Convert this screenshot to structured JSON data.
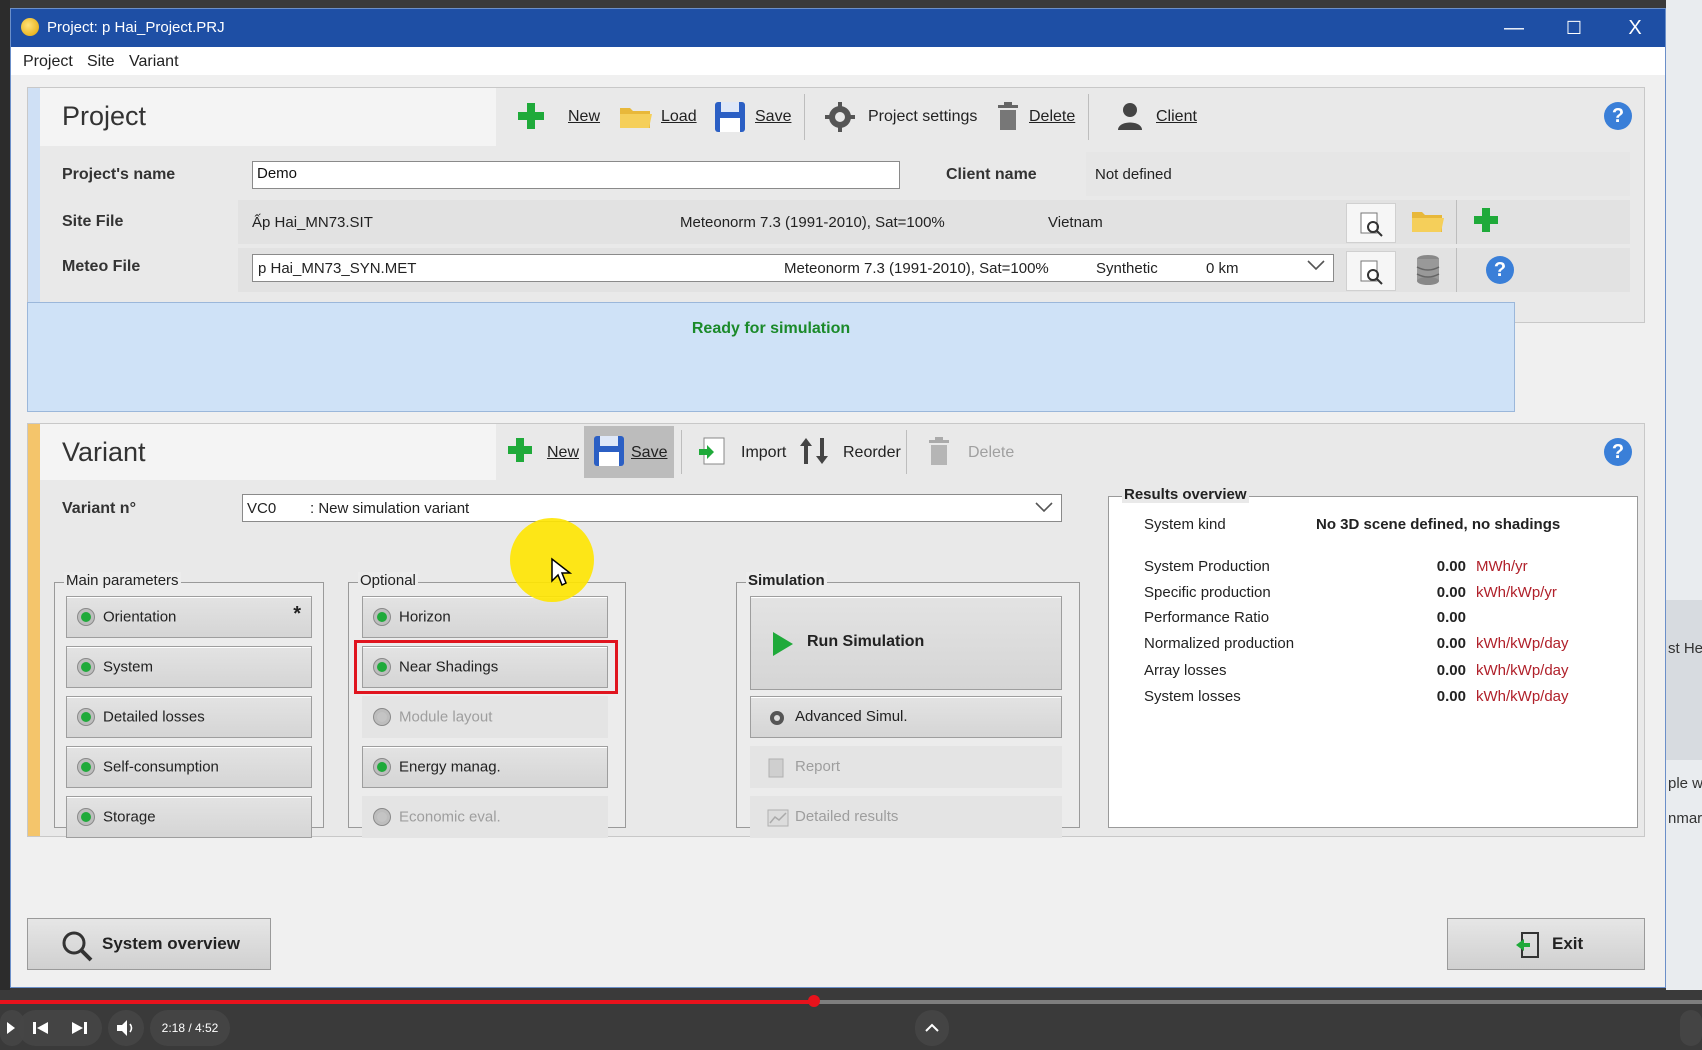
{
  "window": {
    "title": "Project:  p Hai_Project.PRJ",
    "minimize": "—",
    "maximize": "☐",
    "close": "X"
  },
  "menu": [
    "Project",
    "Site",
    "Variant"
  ],
  "project_panel": {
    "title": "Project",
    "toolbar": {
      "new": "New",
      "load": "Load",
      "save": "Save",
      "settings": "Project settings",
      "delete": "Delete",
      "client": "Client"
    },
    "project_name_label": "Project's name",
    "project_name_value": "Demo",
    "client_name_label": "Client name",
    "client_name_value": "Not defined",
    "site_file_label": "Site File",
    "site_file_name": "Ấp Hai_MN73.SIT",
    "site_file_source": "Meteonorm 7.3 (1991-2010), Sat=100%",
    "site_file_country": "Vietnam",
    "meteo_file_label": "Meteo File",
    "meteo_file_name": "p Hai_MN73_SYN.MET",
    "meteo_file_source": "Meteonorm 7.3 (1991-2010), Sat=100%",
    "meteo_file_type": "Synthetic",
    "meteo_file_distance": "0 km"
  },
  "status": {
    "text": "Ready for simulation",
    "color": "#1b8a2a"
  },
  "variant_panel": {
    "title": "Variant",
    "toolbar": {
      "new": "New",
      "save": "Save",
      "import": "Import",
      "reorder": "Reorder",
      "delete": "Delete"
    },
    "variant_label": "Variant n°",
    "variant_code": "VC0",
    "variant_name": ": New simulation variant"
  },
  "main_parameters": {
    "legend": "Main parameters",
    "items": [
      "Orientation",
      "System",
      "Detailed losses",
      "Self-consumption",
      "Storage"
    ],
    "orientation_marker": "*"
  },
  "optional": {
    "legend": "Optional",
    "items": [
      "Horizon",
      "Near Shadings",
      "Module layout",
      "Energy manag.",
      "Economic eval."
    ]
  },
  "simulation": {
    "legend": "Simulation",
    "run": "Run Simulation",
    "advanced": "Advanced Simul.",
    "report": "Report",
    "detailed": "Detailed results"
  },
  "results": {
    "legend": "Results overview",
    "system_kind_label": "System kind",
    "system_kind_value": "No 3D scene defined, no shadings",
    "rows": [
      {
        "label": "System Production",
        "value": "0.00",
        "unit": "MWh/yr"
      },
      {
        "label": "Specific production",
        "value": "0.00",
        "unit": "kWh/kWp/yr"
      },
      {
        "label": "Performance Ratio",
        "value": "0.00",
        "unit": ""
      },
      {
        "label": "Normalized production",
        "value": "0.00",
        "unit": "kWh/kWp/day"
      },
      {
        "label": "Array losses",
        "value": "0.00",
        "unit": "kWh/kWp/day"
      },
      {
        "label": "System losses",
        "value": "0.00",
        "unit": "kWh/kWp/day"
      }
    ]
  },
  "footer": {
    "system_overview": "System overview",
    "exit": "Exit"
  },
  "video": {
    "time": "2:18 / 4:52",
    "progress_fraction": 0.478
  },
  "background": {
    "right_text_1": "st He",
    "right_text_2": "ple w",
    "right_text_3": "nmark"
  },
  "colors": {
    "titlebar": "#1e4fa5",
    "status_bg": "#cfe2f7",
    "accent_green": "#1faa3a",
    "highlight_red": "#e0141e",
    "unit_red": "#b0202a",
    "progress_red": "#e8121c"
  }
}
